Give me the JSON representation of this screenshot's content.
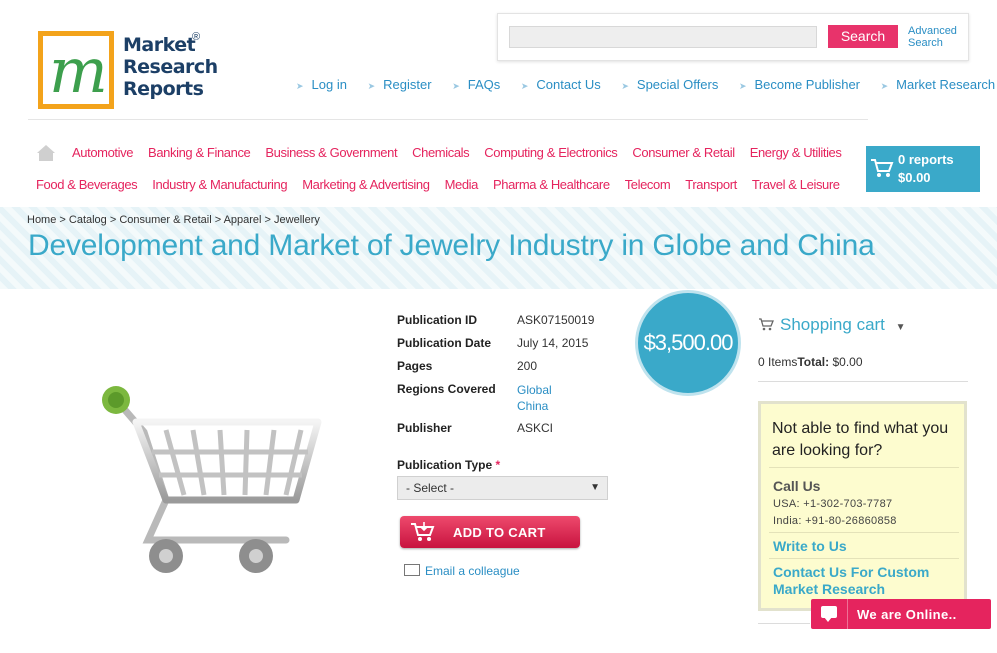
{
  "logo": {
    "line1": "Market",
    "line2": "Research",
    "line3": "Reports",
    "reg": "®",
    "mark": "m"
  },
  "search": {
    "placeholder": "",
    "button": "Search",
    "advanced_line1": "Advanced",
    "advanced_line2": "Search"
  },
  "top_nav": [
    "Log in",
    "Register",
    "FAQs",
    "Contact Us",
    "Special Offers",
    "Become Publisher",
    "Market Research Blog"
  ],
  "categories_row1": [
    "Automotive",
    "Banking & Finance",
    "Business & Government",
    "Chemicals",
    "Computing & Electronics",
    "Consumer & Retail",
    "Energy & Utilities"
  ],
  "categories_row2": [
    "Food & Beverages",
    "Industry & Manufacturing",
    "Marketing & Advertising",
    "Media",
    "Pharma & Healthcare",
    "Telecom",
    "Transport",
    "Travel & Leisure"
  ],
  "header_cart": {
    "reports": "0 reports",
    "total": "$0.00"
  },
  "breadcrumb": "Home > Catalog > Consumer & Retail > Apparel > Jewellery",
  "title": "Development and Market of Jewelry Industry in Globe and China",
  "details": {
    "pub_id_label": "Publication ID",
    "pub_id": "ASK07150019",
    "pub_date_label": "Publication Date",
    "pub_date": "July 14, 2015",
    "pages_label": "Pages",
    "pages": "200",
    "regions_label": "Regions Covered",
    "region1": "Global",
    "region2": "China",
    "publisher_label": "Publisher",
    "publisher": "ASKCI"
  },
  "publication_type": {
    "label": "Publication Type",
    "required": "*",
    "selected": "- Select -"
  },
  "add_to_cart": "ADD TO CART",
  "email_colleague": "Email a colleague",
  "price": "$3,500.00",
  "shopping_cart": {
    "heading": "Shopping cart",
    "items": "0 Items",
    "total_label": "Total:",
    "total": "$0.00"
  },
  "help": {
    "question": "Not able to find what you are looking for?",
    "call_us": "Call Us",
    "usa": "USA: +1-302-703-7787",
    "india": "India: +91-80-26860858",
    "write": "Write to Us",
    "custom": "Contact Us For Custom Market Research"
  },
  "chat": "We are Online..",
  "colors": {
    "pink": "#e5245e",
    "blue": "#3aa9c9",
    "link": "#2a8ec4"
  }
}
